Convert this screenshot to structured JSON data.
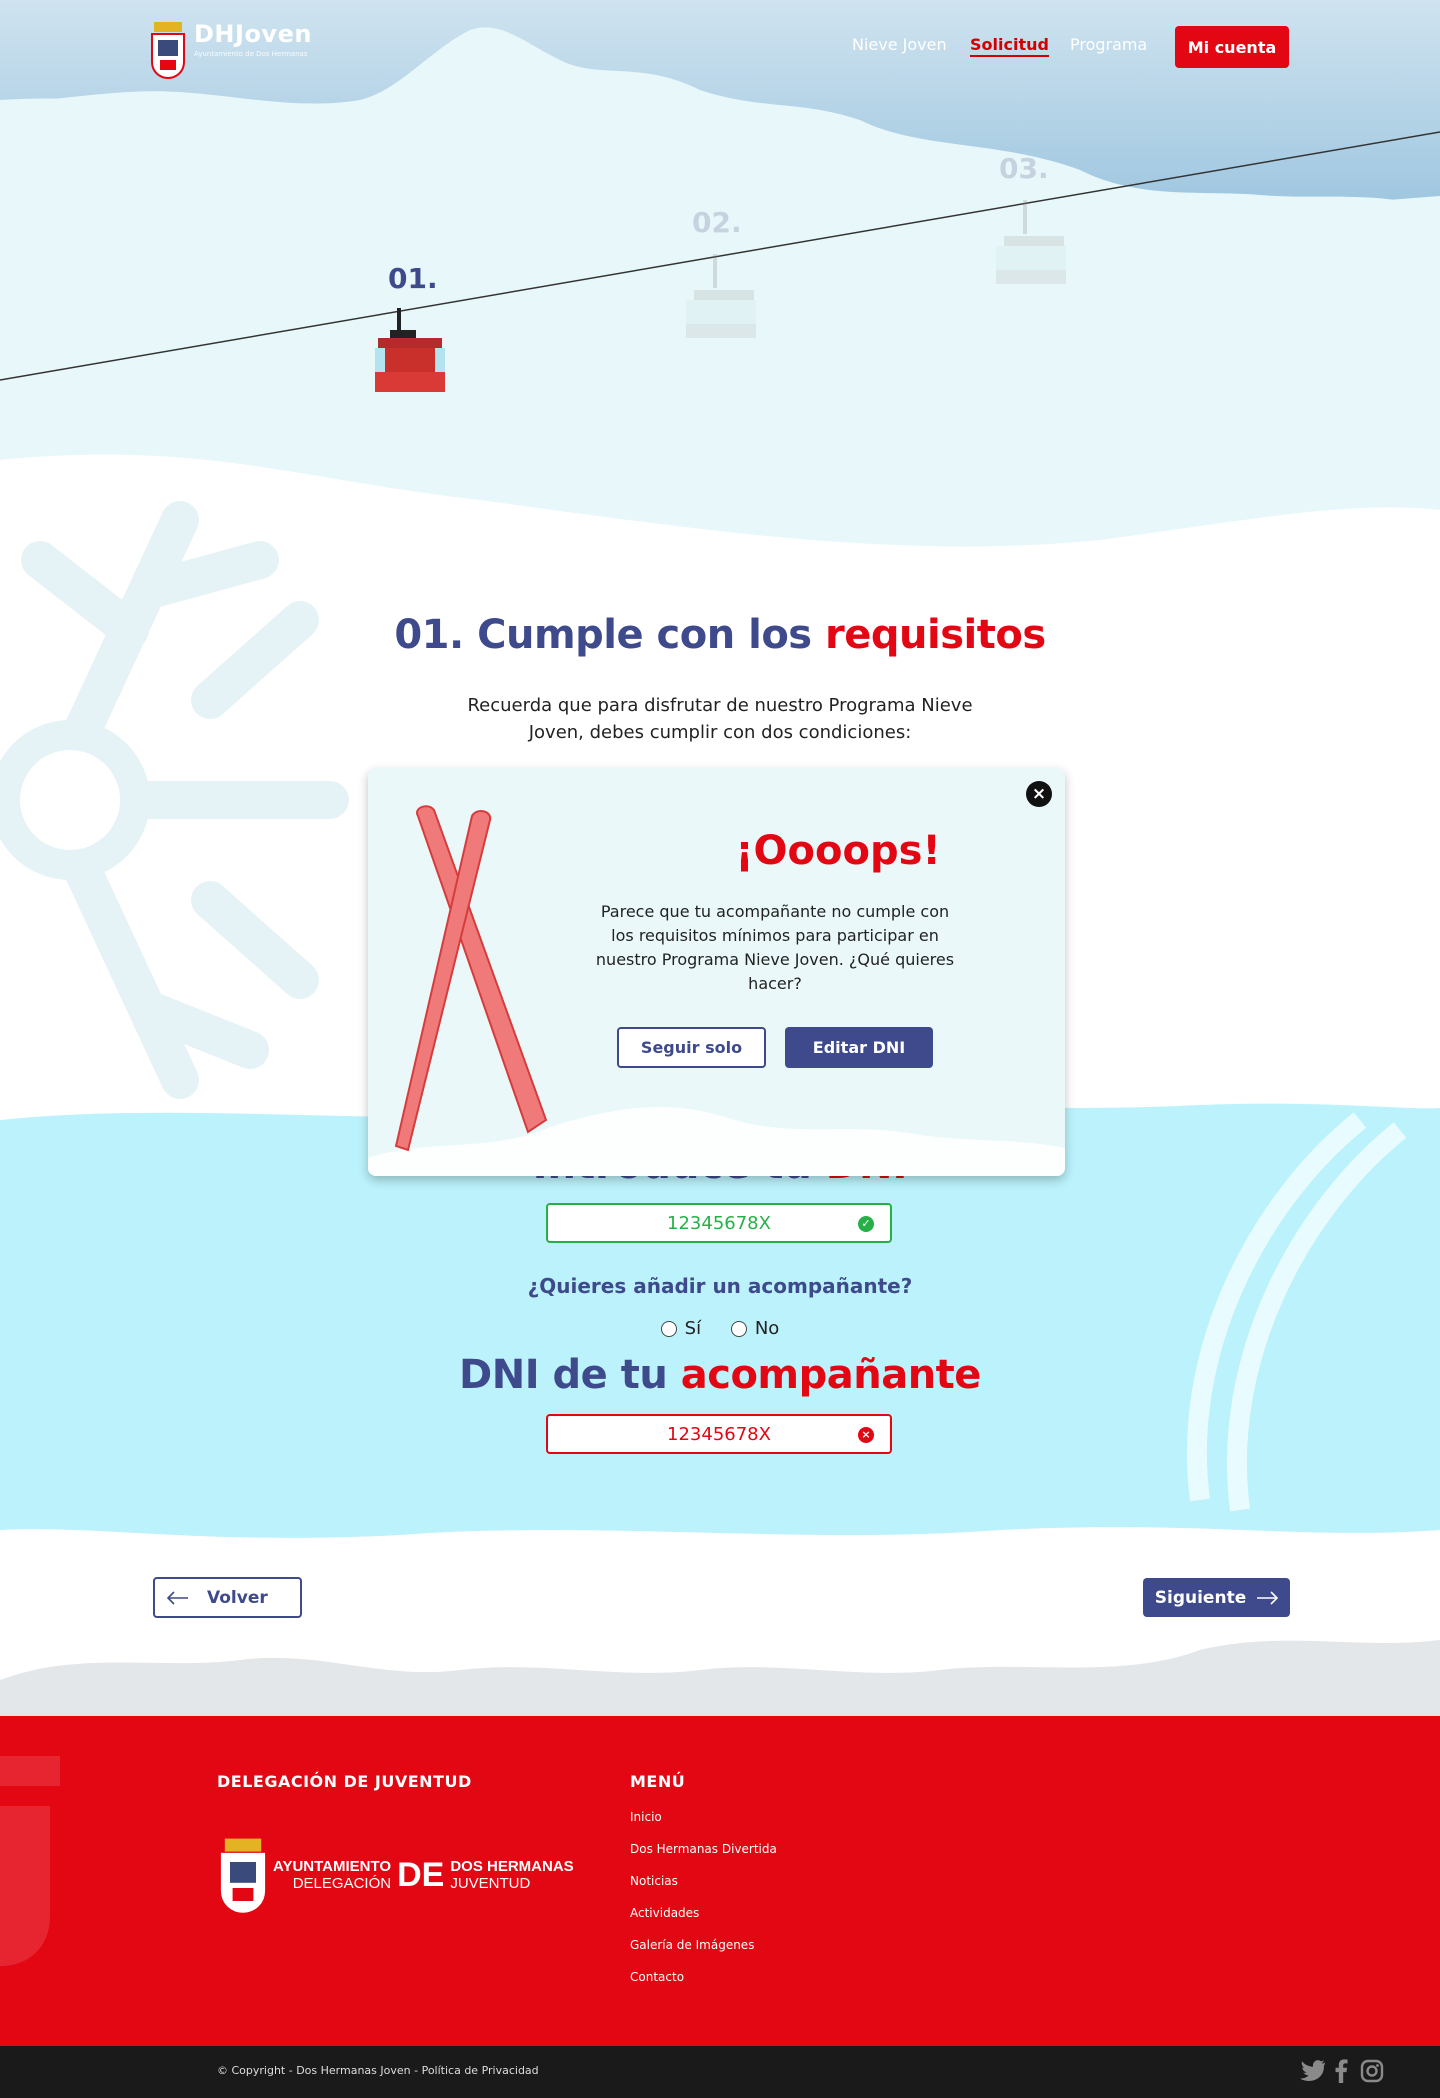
{
  "header": {
    "logo_title": "DHJoven",
    "logo_subtitle": "Ayuntamiento de Dos Hermanas",
    "nav": [
      {
        "label": "Nieve Joven"
      },
      {
        "label": "Solicitud"
      },
      {
        "label": "Programa"
      }
    ],
    "account_button": "Mi cuenta"
  },
  "steps": [
    "01.",
    "02.",
    "03."
  ],
  "main": {
    "title_part1": "01. Cumple con los ",
    "title_part2": "requisitos",
    "intro": "Recuerda que para disfrutar de nuestro Programa Nieve Joven, debes cumplir con dos condiciones:",
    "dni_heading_part1": "Introduce tu ",
    "dni_heading_part2": "DNI",
    "dni_value": "12345678X",
    "companion_question": "¿Quieres añadir un acompañante?",
    "radio_yes": "Sí",
    "radio_no": "No",
    "companion_heading_part1": "DNI de tu ",
    "companion_heading_part2": "acompañante",
    "companion_dni_value": "12345678X",
    "back_button": "Volver",
    "next_button": "Siguiente"
  },
  "modal": {
    "title": "¡Oooops!",
    "text": "Parece que tu acompañante no cumple con los requisitos mínimos para participar en nuestro Programa Nieve Joven. ¿Qué quieres hacer?",
    "button_alone": "Seguir solo",
    "button_edit": "Editar DNI"
  },
  "footer": {
    "delegation_heading": "DELEGACIÓN DE JUVENTUD",
    "menu_heading": "MENÚ",
    "logo_line1a": "AYUNTAMIENTO",
    "logo_line2a": "DELEGACIÓN",
    "logo_de": "DE",
    "logo_line1b": "DOS HERMANAS",
    "logo_line2b": "JUVENTUD",
    "menu": [
      "Inicio",
      "Dos Hermanas Divertida",
      "Noticias",
      "Actividades",
      "Galería de Imágenes",
      "Contacto"
    ],
    "copyright": "© Copyright - Dos Hermanas Joven - Política de Privacidad"
  },
  "colors": {
    "primary": "#3e4a8c",
    "accent": "#e30613",
    "success": "#27b048",
    "sky": "#bfeefc"
  }
}
